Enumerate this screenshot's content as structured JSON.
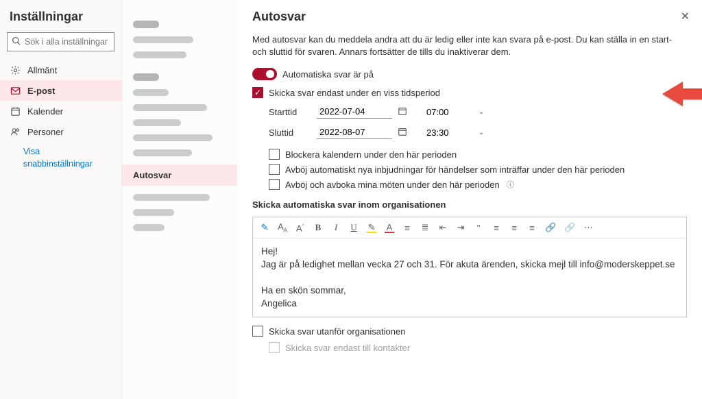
{
  "sidebar": {
    "title": "Inställningar",
    "search_placeholder": "Sök i alla inställningar",
    "items": [
      {
        "label": "Allmänt"
      },
      {
        "label": "E-post"
      },
      {
        "label": "Kalender"
      },
      {
        "label": "Personer"
      }
    ],
    "quick": "Visa\nsnabbinställningar"
  },
  "midnav": {
    "selected": "Autosvar"
  },
  "main": {
    "title": "Autosvar",
    "desc": "Med autosvar kan du meddela andra att du är ledig eller inte kan svara på e-post. Du kan ställa in en start- och sluttid för svaren. Annars fortsätter de tills du inaktiverar dem.",
    "toggle_label": "Automatiska svar är på",
    "period_check": "Skicka svar endast under en viss tidsperiod",
    "start_label": "Starttid",
    "start_date": "2022-07-04",
    "start_time": "07:00",
    "end_label": "Sluttid",
    "end_date": "2022-08-07",
    "end_time": "23:30",
    "opt_block": "Blockera kalendern under den här perioden",
    "opt_decline_new": "Avböj automatiskt nya inbjudningar för händelser som inträffar under den här perioden",
    "opt_cancel": "Avböj och avboka mina möten under den här perioden",
    "section_inside": "Skicka automatiska svar inom organisationen",
    "body_line1": "Hej!",
    "body_line2": "Jag är på ledighet mellan vecka 27 och 31. För akuta ärenden, skicka mejl till info@moderskeppet.se",
    "body_line3": "Ha en skön sommar,",
    "body_line4": "Angelica",
    "outside_check": "Skicka svar utanför organisationen",
    "outside_contacts": "Skicka svar endast till kontakter"
  }
}
